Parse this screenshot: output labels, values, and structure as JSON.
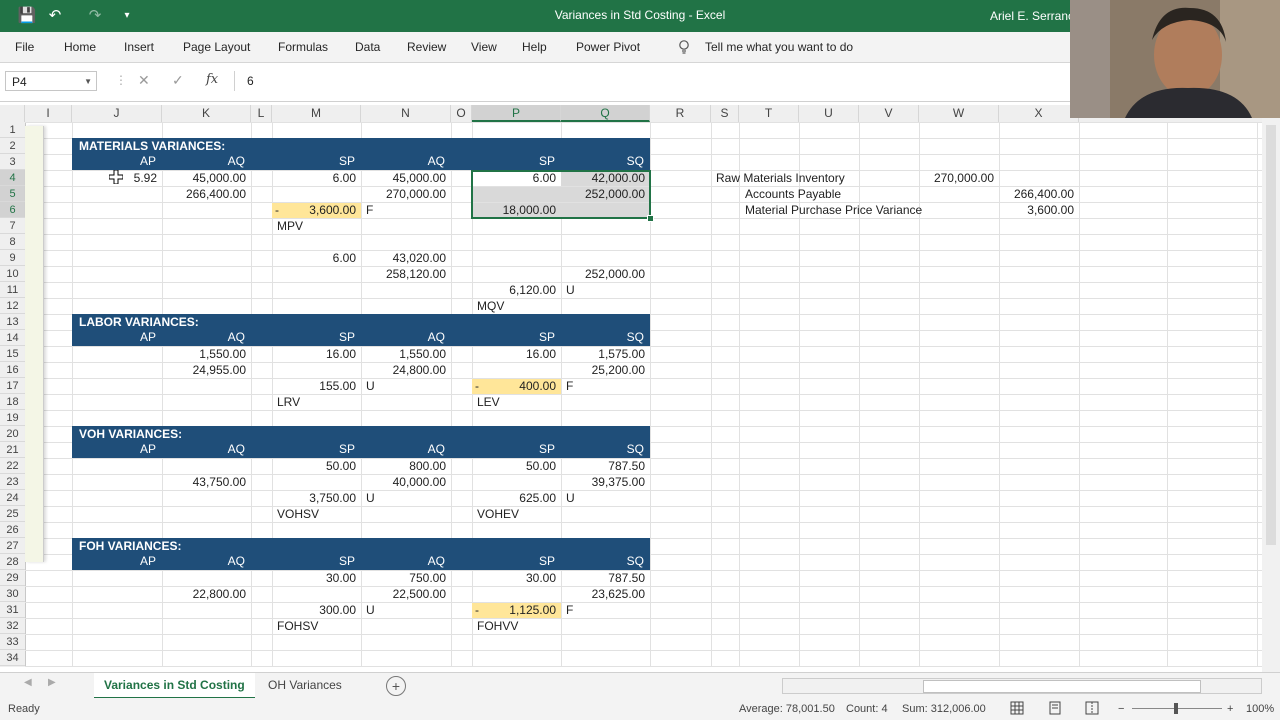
{
  "app": {
    "title": "Variances in Std Costing  -  Excel",
    "user": "Ariel E. Serrano",
    "qat_save": "💾",
    "qat_undo": "↶",
    "qat_redo": "↷",
    "qat_more": "▾"
  },
  "ribbon": {
    "tabs": [
      "File",
      "Home",
      "Insert",
      "Page Layout",
      "Formulas",
      "Data",
      "Review",
      "View",
      "Help",
      "Power Pivot"
    ],
    "tell_me": "Tell me what you want to do"
  },
  "formula_bar": {
    "name_box": "P4",
    "value": "6",
    "fx": "fx",
    "cancel": "✕",
    "enter": "✓"
  },
  "grid": {
    "columns": [
      "I",
      "J",
      "K",
      "L",
      "M",
      "N",
      "O",
      "P",
      "Q",
      "R",
      "S",
      "T",
      "U",
      "V",
      "W",
      "X"
    ],
    "rows": [
      "1",
      "2",
      "3",
      "4",
      "5",
      "6",
      "7",
      "8",
      "9",
      "10",
      "11",
      "12",
      "13",
      "14",
      "15",
      "16",
      "17",
      "18",
      "19",
      "20",
      "21",
      "22",
      "23",
      "24",
      "25",
      "26",
      "27",
      "28",
      "29",
      "30",
      "31",
      "32",
      "33",
      "34"
    ],
    "sections": [
      {
        "title": "MATERIALS VARIANCES:",
        "headers": [
          "AP",
          "AQ",
          "SP",
          "AQ",
          "SP",
          "SQ"
        ]
      },
      {
        "title": "LABOR VARIANCES:",
        "headers": [
          "AP",
          "AQ",
          "SP",
          "AQ",
          "SP",
          "SQ"
        ]
      },
      {
        "title": "VOH VARIANCES:",
        "headers": [
          "AP",
          "AQ",
          "SP",
          "AQ",
          "SP",
          "SQ"
        ]
      },
      {
        "title": "FOH VARIANCES:",
        "headers": [
          "AP",
          "AQ",
          "SP",
          "AQ",
          "SP",
          "SQ"
        ]
      }
    ],
    "materials": {
      "j4": "5.92",
      "k4": "45,000.00",
      "m4": "6.00",
      "n4": "45,000.00",
      "p4": "6.00",
      "q4": "42,000.00",
      "k5": "266,400.00",
      "n5": "270,000.00",
      "q5": "252,000.00",
      "m6_dash": "-",
      "m6": "3,600.00",
      "m6_flag": "F",
      "p6": "18,000.00",
      "m7": "MPV",
      "m9": "6.00",
      "n9": "43,020.00",
      "n10": "258,120.00",
      "q10": "252,000.00",
      "p11": "6,120.00",
      "p11_flag": "U",
      "p12": "MQV"
    },
    "labor": {
      "k15": "1,550.00",
      "m15": "16.00",
      "n15": "1,550.00",
      "p15": "16.00",
      "q15": "1,575.00",
      "k16": "24,955.00",
      "n16": "24,800.00",
      "q16": "25,200.00",
      "m17": "155.00",
      "m17_flag": "U",
      "p17_dash": "-",
      "p17": "400.00",
      "p17_flag": "F",
      "m18": "LRV",
      "p18": "LEV"
    },
    "voh": {
      "m22": "50.00",
      "n22": "800.00",
      "p22": "50.00",
      "q22": "787.50",
      "k23": "43,750.00",
      "n23": "40,000.00",
      "q23": "39,375.00",
      "m24": "3,750.00",
      "m24_flag": "U",
      "p24": "625.00",
      "p24_flag": "U",
      "m25": "VOHSV",
      "p25": "VOHEV"
    },
    "foh": {
      "m29": "30.00",
      "n29": "750.00",
      "p29": "30.00",
      "q29": "787.50",
      "k30": "22,800.00",
      "n30": "22,500.00",
      "q30": "23,625.00",
      "m31": "300.00",
      "m31_flag": "U",
      "p31_dash": "-",
      "p31": "1,125.00",
      "p31_flag": "F",
      "m32": "FOHSV",
      "p32": "FOHVV"
    },
    "journal": {
      "t4": "Raw Materials Inventory",
      "w4": "270,000.00",
      "t5": "Accounts Payable",
      "x5": "266,400.00",
      "t6": "Material Purchase Price Variance",
      "x6": "3,600.00"
    }
  },
  "sheets": {
    "active": "Variances in Std Costing",
    "other": "OH Variances",
    "add": "+"
  },
  "status": {
    "ready": "Ready",
    "average": "Average: 78,001.50",
    "count": "Count: 4",
    "sum": "Sum: 312,006.00",
    "zoom": "100%",
    "zoom_minus": "−",
    "zoom_plus": "+"
  }
}
